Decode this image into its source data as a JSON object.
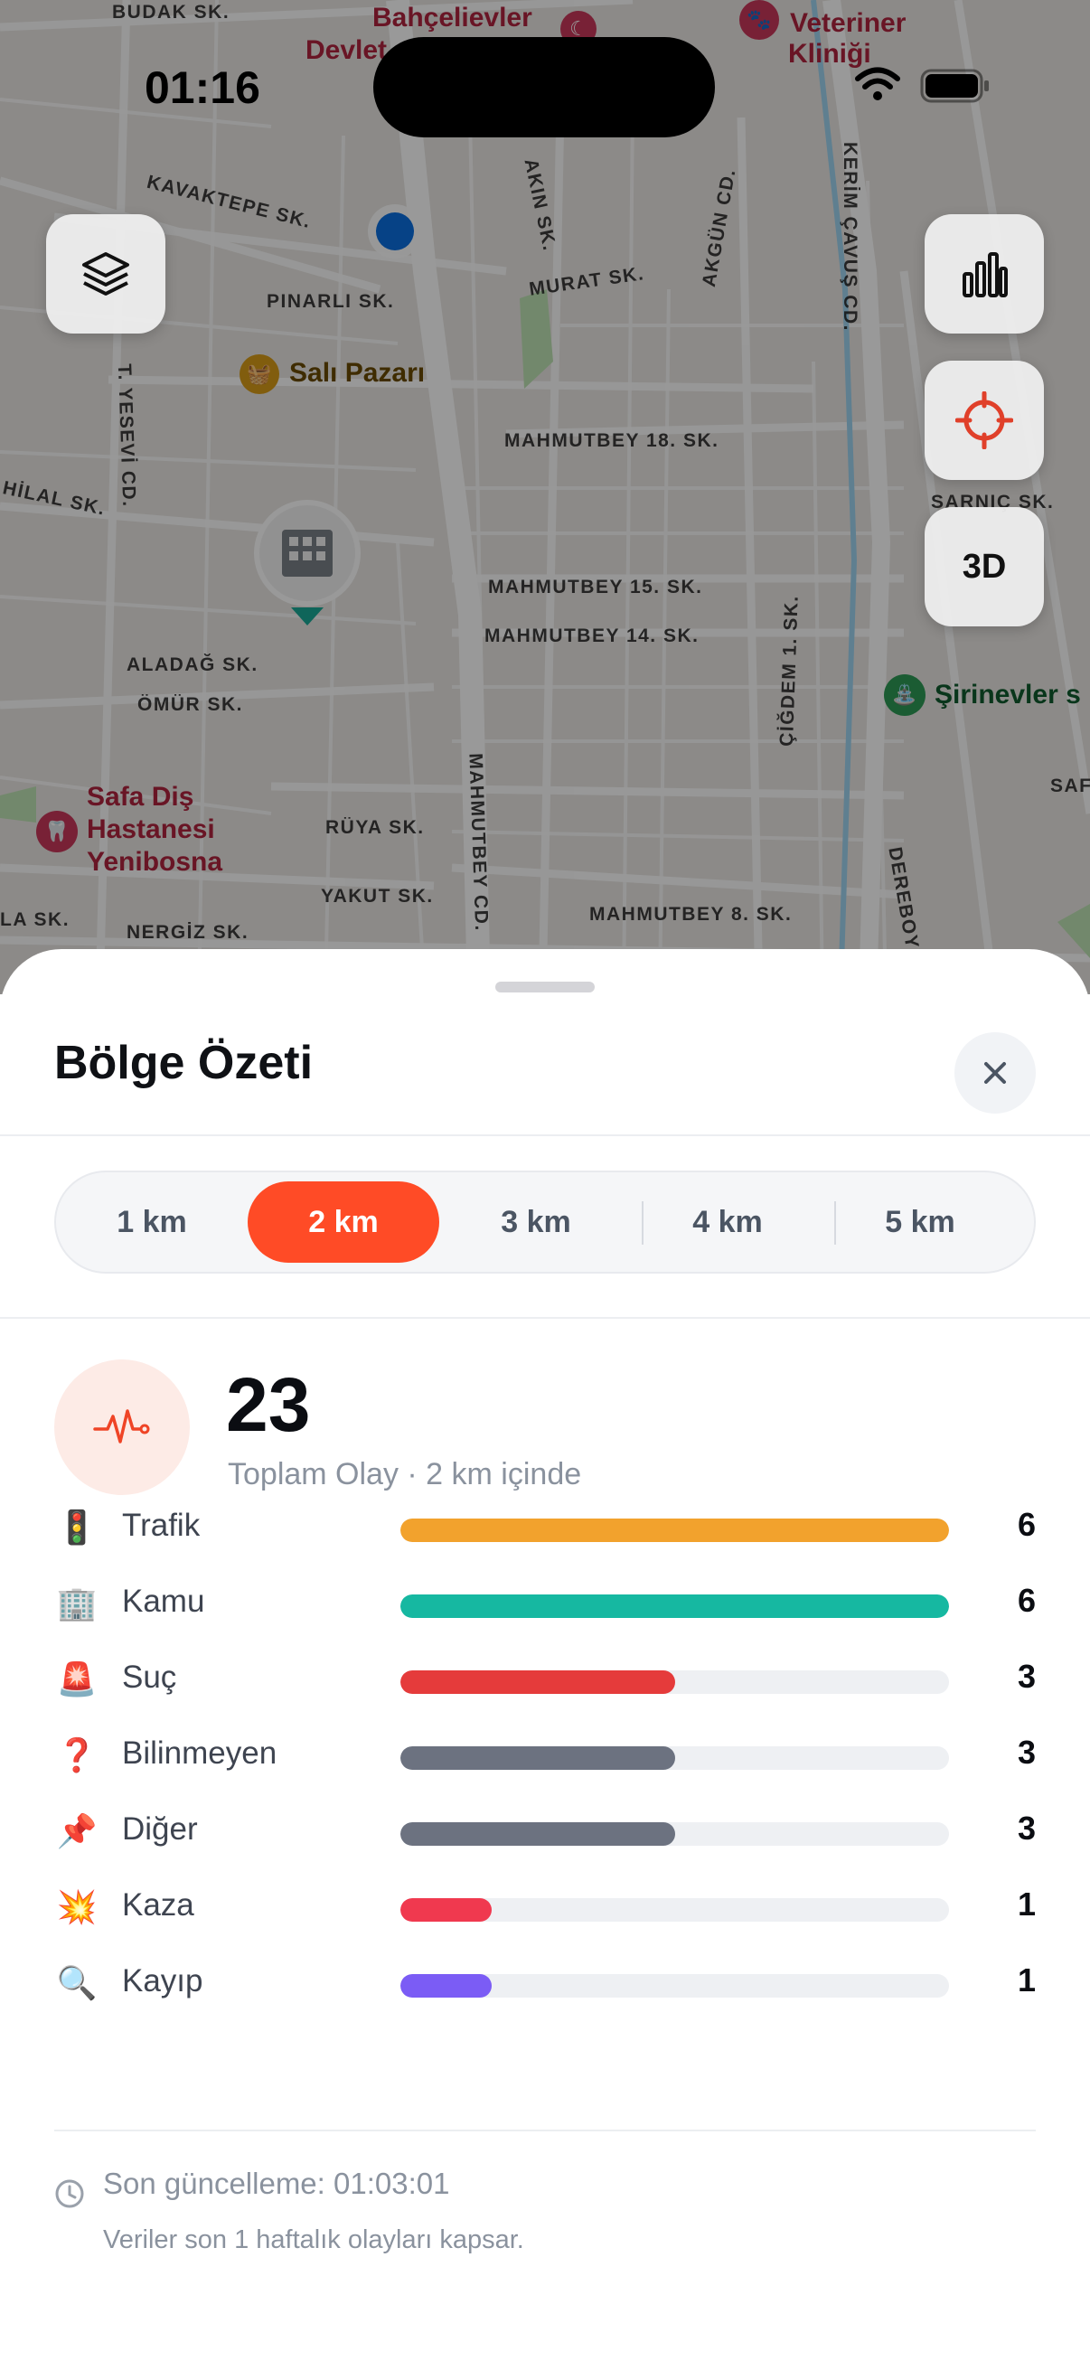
{
  "status_bar": {
    "time": "01:16"
  },
  "map": {
    "streets": [
      "BUDAK SK.",
      "KAVAKTEPE SK.",
      "PINARLI SK.",
      "AKIN SK.",
      "MURAT SK.",
      "AKGÜN CD.",
      "KERİM ÇAVUŞ CD.",
      "T. YESEVİ CD.",
      "HİLAL SK.",
      "MAHMUTBEY 18. SK.",
      "SARNIÇ SK.",
      "MAHMUTBEY 15. SK.",
      "MAHMUTBEY 14. SK.",
      "ALADAĞ SK.",
      "ÖMÜR SK.",
      "ÇİĞDEM 1. SK.",
      "RÜYA SK.",
      "YAKUT SK.",
      "MAHMUTBEY CD.",
      "MAHMUTBEY 8. SK.",
      "NERGİZ SK.",
      "LA SK.",
      "DEREBOYU",
      "SAF"
    ],
    "pois": {
      "bahcelievler": "Bahçelievler",
      "devlet": "Devlet",
      "veteriner_1": "Veteriner",
      "veteriner_2": "Kliniği",
      "sali_pazari": "Salı Pazarı",
      "sirinevler": "Şirinevler s",
      "safa_1": "Safa Diş",
      "safa_2": "Hastanesi",
      "safa_3": "Yenibosna"
    },
    "buttons": {
      "three_d": "3D"
    },
    "colors": {
      "locate": "#e0402a",
      "user_dot": "#0a6fe0",
      "marker_tail": "#1aa897"
    }
  },
  "sheet": {
    "title": "Bölge Özeti",
    "radius_options": [
      {
        "label": "1 km",
        "active": false
      },
      {
        "label": "2 km",
        "active": true
      },
      {
        "label": "3 km",
        "active": false
      },
      {
        "label": "4 km",
        "active": false
      },
      {
        "label": "5 km",
        "active": false
      }
    ],
    "total": {
      "count": "23",
      "caption": "Toplam Olay · 2 km içinde",
      "icon": "pulse-icon",
      "icon_color": "#ef4426"
    },
    "max_count": 6,
    "categories": [
      {
        "emoji": "🚦",
        "icon": "traffic-light-icon",
        "label": "Trafik",
        "count": 6,
        "color": "#f2a22d"
      },
      {
        "emoji": "🏢",
        "icon": "building-icon",
        "label": "Kamu",
        "count": 6,
        "color": "#16b8a1"
      },
      {
        "emoji": "🚨",
        "icon": "siren-icon",
        "label": "Suç",
        "count": 3,
        "color": "#e53b3b"
      },
      {
        "emoji": "❓",
        "icon": "question-icon",
        "label": "Bilinmeyen",
        "count": 3,
        "color": "#6c7280"
      },
      {
        "emoji": "📌",
        "icon": "pin-icon",
        "label": "Diğer",
        "count": 3,
        "color": "#6c7280"
      },
      {
        "emoji": "💥",
        "icon": "collision-icon",
        "label": "Kaza",
        "count": 1,
        "color": "#f0394f"
      },
      {
        "emoji": "🔍",
        "icon": "magnifier-icon",
        "label": "Kayıp",
        "count": 1,
        "color": "#7b5cf5"
      }
    ],
    "footer": {
      "last_update": "Son güncelleme: 01:03:01",
      "note": "Veriler son 1 haftalık olayları kapsar."
    }
  }
}
